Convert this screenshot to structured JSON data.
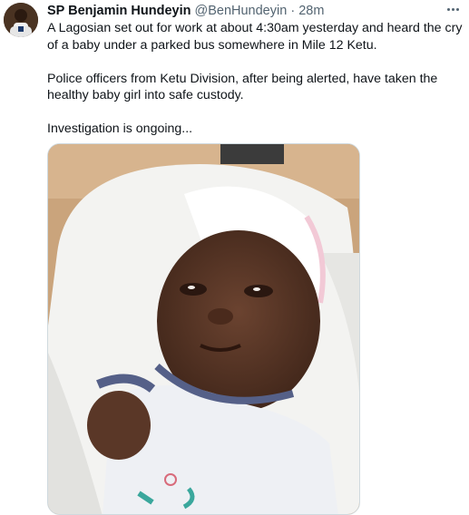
{
  "author": {
    "name": "SP Benjamin Hundeyin",
    "handle": "@BenHundeyin",
    "separator": "·",
    "timestamp": "28m"
  },
  "more_icon": "more-horizontal-icon",
  "tweet": {
    "paragraphs": [
      "A Lagosian set out for work at about 4:30am yesterday and heard the cry of a baby under a parked bus somewhere in Mile 12 Ketu.",
      "Police officers from Ketu Division, after being alerted, have taken the healthy baby girl into safe custody.",
      "Investigation is ongoing..."
    ]
  },
  "colors": {
    "text": "#0f1419",
    "secondary": "#536471",
    "border": "#cfd9de"
  }
}
